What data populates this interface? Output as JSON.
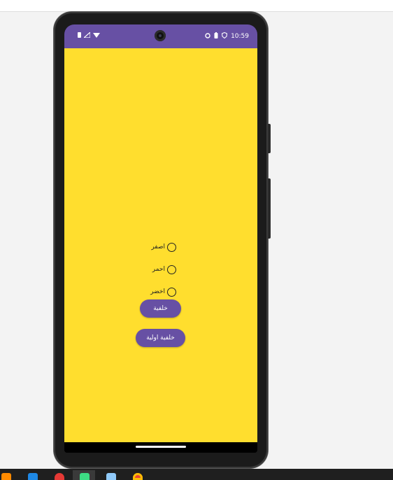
{
  "status_bar": {
    "time": "10:59",
    "left_icons": [
      "notification-icon",
      "signal-icon",
      "wifi-icon"
    ],
    "right_icons": [
      "sync-icon",
      "battery-saver-icon",
      "shield-icon"
    ],
    "color": "#6750a4"
  },
  "app": {
    "background_color": "#ffde2e",
    "radio_options": [
      {
        "label": "اصفر"
      },
      {
        "label": "احمر"
      },
      {
        "label": "اخضر"
      }
    ],
    "buttons": {
      "background_label": "خلفية",
      "initial_background_label": "خلفية اولية"
    },
    "accent_color": "#6750a4"
  },
  "taskbar": {
    "icons": [
      "firefox-icon",
      "mail-icon",
      "opera-icon",
      "android-studio-icon",
      "notepad-icon",
      "chrome-icon"
    ]
  }
}
